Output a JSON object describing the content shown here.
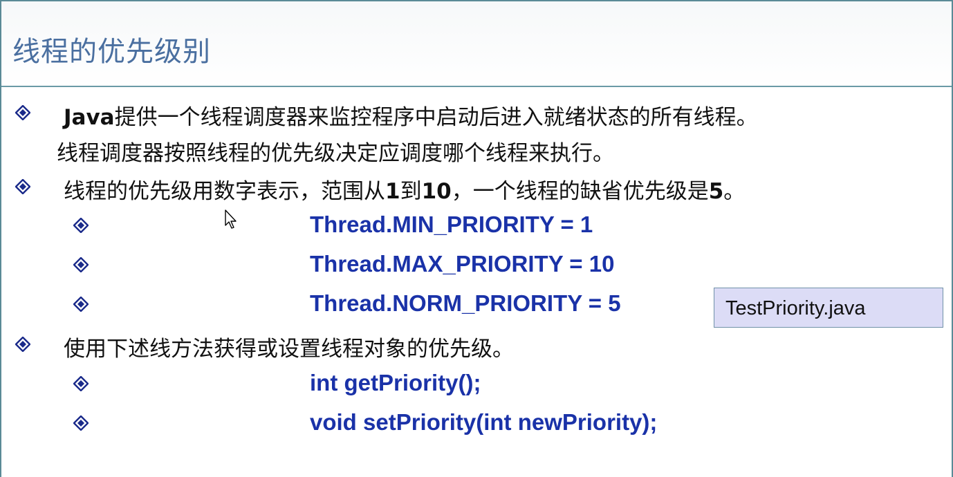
{
  "slide": {
    "title": "线程的优先级别",
    "bullets": [
      {
        "line1_prefix": "Java",
        "line1_rest": "提供一个线程调度器来监控程序中启动后进入就绪状态的所有线程。",
        "line2": "线程调度器按照线程的优先级决定应调度哪个线程来执行。"
      },
      {
        "seg1": "线程的优先级用数字表示，范围从",
        "num1": "1",
        "seg2": "到",
        "num2": "10",
        "seg3": "，一个线程的缺省优先级是",
        "num3": "5",
        "seg4": "。"
      },
      {
        "text": "使用下述线方法获得或设置线程对象的优先级。"
      }
    ],
    "priority_constants": [
      "Thread.MIN_PRIORITY = 1",
      "Thread.MAX_PRIORITY = 10",
      "Thread.NORM_PRIORITY = 5"
    ],
    "methods": [
      "int getPriority();",
      "void setPriority(int newPriority);"
    ],
    "file_label": "TestPriority.java"
  },
  "colors": {
    "title": "#4a6fa0",
    "code": "#1a32a8",
    "diamond_outer": "#1a2a8a",
    "diamond_inner": "#a0b4ff",
    "file_box_bg": "#dcdcf6"
  },
  "icons": {
    "bullet": "diamond-bullet-icon",
    "cursor": "mouse-pointer-icon"
  }
}
